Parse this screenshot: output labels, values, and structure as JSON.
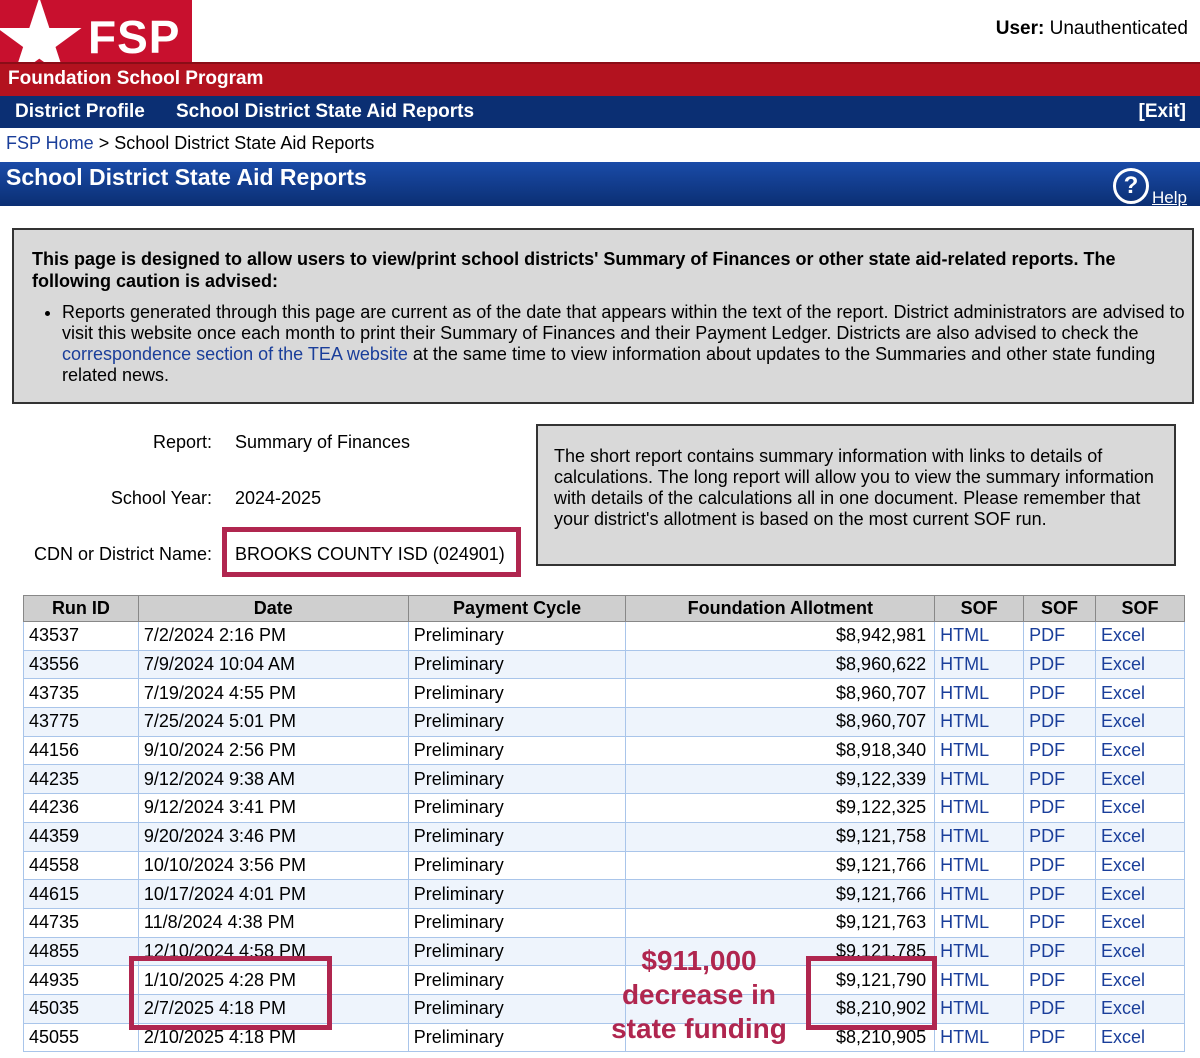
{
  "header": {
    "logo_text": "FSP",
    "user_label": "User:",
    "user_value": "Unauthenticated",
    "program_name": "Foundation School Program"
  },
  "nav": {
    "district_profile": "District Profile",
    "state_aid_reports": "School District State Aid Reports",
    "exit": "[Exit]"
  },
  "breadcrumb": {
    "home": "FSP Home",
    "separator": ">",
    "current": "School District State Aid Reports"
  },
  "page": {
    "title": "School District State Aid Reports",
    "help_label": "Help",
    "help_icon": "question-circle-icon"
  },
  "caution": {
    "heading": "This page is designed to allow users to view/print school districts' Summary of Finances or other state aid-related reports. The following caution is advised:",
    "bullet_before": "Reports generated through this page are current as of the date that appears within the text of the report. District administrators are advised to visit this website once each month to print their Summary of Finances and their Payment Ledger. Districts are also advised to check the ",
    "bullet_link": "correspondence section of the TEA website",
    "bullet_after": " at the same time to view information about updates to the Summaries and other state funding related news."
  },
  "fields": {
    "report_label": "Report:",
    "report_value": "Summary of Finances",
    "year_label": "School Year:",
    "year_value": "2024-2025",
    "district_label": "CDN or District Name:",
    "district_value": "BROOKS COUNTY ISD (024901)"
  },
  "info_box": "The short report contains summary information with links to details of calculations. The long report will allow you to view the summary information with details of the calculations all in one document. Please remember that your district's allotment is based on the most current SOF run.",
  "table": {
    "headers": [
      "Run ID",
      "Date",
      "Payment Cycle",
      "Foundation Allotment",
      "SOF",
      "SOF",
      "SOF"
    ],
    "rows": [
      [
        "43537",
        "7/2/2024 2:16 PM",
        "Preliminary",
        "$8,942,981",
        "HTML",
        "PDF",
        "Excel"
      ],
      [
        "43556",
        "7/9/2024 10:04 AM",
        "Preliminary",
        "$8,960,622",
        "HTML",
        "PDF",
        "Excel"
      ],
      [
        "43735",
        "7/19/2024 4:55 PM",
        "Preliminary",
        "$8,960,707",
        "HTML",
        "PDF",
        "Excel"
      ],
      [
        "43775",
        "7/25/2024 5:01 PM",
        "Preliminary",
        "$8,960,707",
        "HTML",
        "PDF",
        "Excel"
      ],
      [
        "44156",
        "9/10/2024 2:56 PM",
        "Preliminary",
        "$8,918,340",
        "HTML",
        "PDF",
        "Excel"
      ],
      [
        "44235",
        "9/12/2024 9:38 AM",
        "Preliminary",
        "$9,122,339",
        "HTML",
        "PDF",
        "Excel"
      ],
      [
        "44236",
        "9/12/2024 3:41 PM",
        "Preliminary",
        "$9,122,325",
        "HTML",
        "PDF",
        "Excel"
      ],
      [
        "44359",
        "9/20/2024 3:46 PM",
        "Preliminary",
        "$9,121,758",
        "HTML",
        "PDF",
        "Excel"
      ],
      [
        "44558",
        "10/10/2024 3:56 PM",
        "Preliminary",
        "$9,121,766",
        "HTML",
        "PDF",
        "Excel"
      ],
      [
        "44615",
        "10/17/2024 4:01 PM",
        "Preliminary",
        "$9,121,766",
        "HTML",
        "PDF",
        "Excel"
      ],
      [
        "44735",
        "11/8/2024 4:38 PM",
        "Preliminary",
        "$9,121,763",
        "HTML",
        "PDF",
        "Excel"
      ],
      [
        "44855",
        "12/10/2024 4:58 PM",
        "Preliminary",
        "$9,121,785",
        "HTML",
        "PDF",
        "Excel"
      ],
      [
        "44935",
        "1/10/2025 4:28 PM",
        "Preliminary",
        "$9,121,790",
        "HTML",
        "PDF",
        "Excel"
      ],
      [
        "45035",
        "2/7/2025 4:18 PM",
        "Preliminary",
        "$8,210,902",
        "HTML",
        "PDF",
        "Excel"
      ],
      [
        "45055",
        "2/10/2025 4:18 PM",
        "Preliminary",
        "$8,210,905",
        "HTML",
        "PDF",
        "Excel"
      ]
    ]
  },
  "annotation": {
    "line1": "$911,000",
    "line2": "decrease in",
    "line3": "state funding",
    "color": "#b0264f"
  },
  "colors": {
    "brand_red": "#b3121f",
    "nav_blue": "#0b2f73",
    "link_blue": "#1a3e9a",
    "highlight": "#b0264f"
  }
}
